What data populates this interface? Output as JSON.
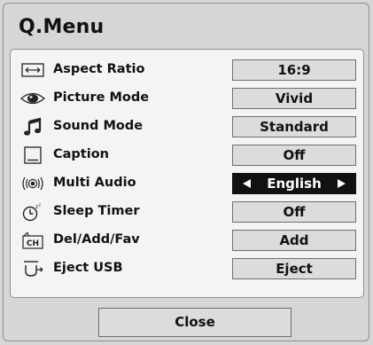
{
  "menu": {
    "title": "Q.Menu",
    "items": [
      {
        "label": "Aspect Ratio",
        "value": "16:9",
        "icon": "aspect-ratio-icon"
      },
      {
        "label": "Picture Mode",
        "value": "Vivid",
        "icon": "eye-icon"
      },
      {
        "label": "Sound Mode",
        "value": "Standard",
        "icon": "music-note-icon"
      },
      {
        "label": "Caption",
        "value": "Off",
        "icon": "caption-icon"
      },
      {
        "label": "Multi Audio",
        "value": "English",
        "icon": "speaker-waves-icon",
        "selected": true
      },
      {
        "label": "Sleep Timer",
        "value": "Off",
        "icon": "sleep-timer-icon"
      },
      {
        "label": "Del/Add/Fav",
        "value": "Add",
        "icon": "channel-icon",
        "icon_text": "CH"
      },
      {
        "label": "Eject USB",
        "value": "Eject",
        "icon": "eject-usb-icon"
      }
    ],
    "close_label": "Close"
  },
  "colors": {
    "background": "#d6d6d6",
    "panel": "#f4f4f4",
    "value_box": "#dcdcdc",
    "selected_box": "#111111",
    "selected_text": "#ffffff"
  }
}
